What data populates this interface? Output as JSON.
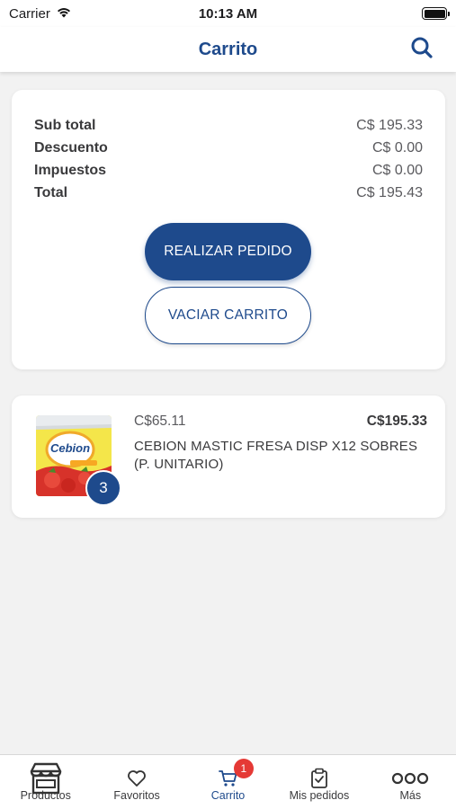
{
  "status_bar": {
    "carrier": "Carrier",
    "time": "10:13 AM"
  },
  "nav": {
    "title": "Carrito",
    "search_icon": "search-icon"
  },
  "summary": {
    "rows": [
      {
        "label": "Sub total",
        "value": "C$ 195.33"
      },
      {
        "label": "Descuento",
        "value": "C$ 0.00"
      },
      {
        "label": "Impuestos",
        "value": "C$ 0.00"
      },
      {
        "label": "Total",
        "value": "C$ 195.43"
      }
    ],
    "place_order_label": "REALIZAR PEDIDO",
    "empty_cart_label": "VACIAR CARRITO"
  },
  "cart_items": [
    {
      "unit_price": "C$65.11",
      "total_price": "C$195.33",
      "name": "CEBION MASTIC FRESA DISP X12 SOBRES (P. UNITARIO)",
      "quantity": "3",
      "image_brand_text": "Cebion"
    }
  ],
  "tab_bar": {
    "items": [
      {
        "label": "Productos",
        "icon": "store-icon"
      },
      {
        "label": "Favoritos",
        "icon": "heart-icon"
      },
      {
        "label": "Carrito",
        "icon": "cart-icon",
        "badge": "1",
        "active": true
      },
      {
        "label": "Mis pedidos",
        "icon": "clipboard-icon"
      },
      {
        "label": "Más",
        "icon": "more-icon"
      }
    ]
  },
  "colors": {
    "primary": "#1e4a8c",
    "badge": "#e53935",
    "background": "#f2f2f2"
  }
}
